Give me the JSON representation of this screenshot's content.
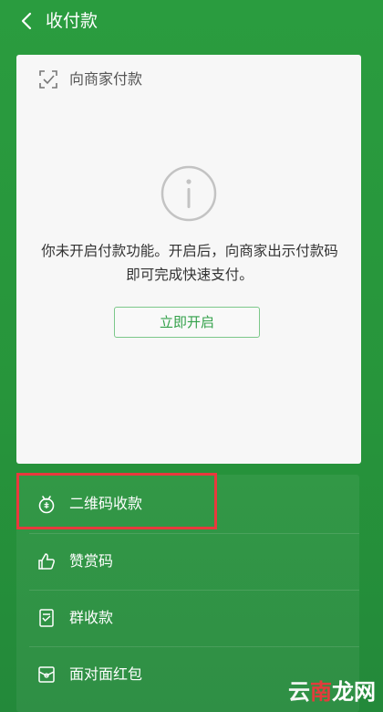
{
  "header": {
    "title": "收付款"
  },
  "card": {
    "title": "向商家付款",
    "message": "你未开启付款功能。开启后，向商家出示付款码即可完成快速支付。",
    "button_label": "立即开启"
  },
  "menu": {
    "items": [
      {
        "label": "二维码收款",
        "icon": "qr-money-bag-icon"
      },
      {
        "label": "赞赏码",
        "icon": "thumbs-up-icon"
      },
      {
        "label": "群收款",
        "icon": "group-receipt-icon"
      },
      {
        "label": "面对面红包",
        "icon": "red-envelope-icon"
      }
    ]
  },
  "watermark": {
    "part1": "云",
    "part2": "南",
    "part3": "龙网"
  },
  "colors": {
    "background": "#27963c",
    "card": "#f7f7f7",
    "accent": "#33a14a",
    "highlight": "#e8393d"
  }
}
